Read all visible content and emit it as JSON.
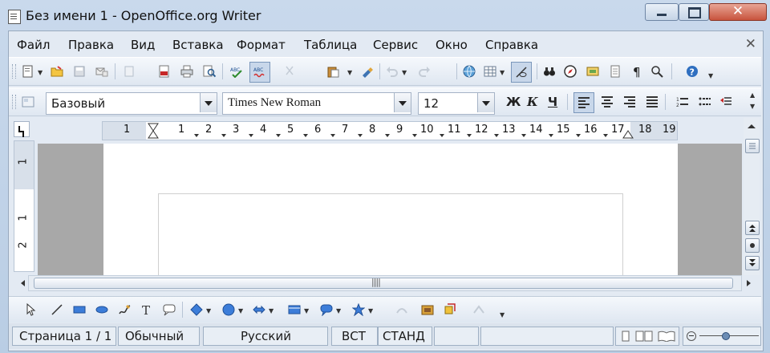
{
  "window": {
    "title": "Без имени 1 - OpenOffice.org Writer"
  },
  "menu": [
    "Файл",
    "Правка",
    "Вид",
    "Вставка",
    "Формат",
    "Таблица",
    "Сервис",
    "Окно",
    "Справка"
  ],
  "formatting": {
    "style": "Базовый",
    "font": "Times New Roman",
    "size": "12",
    "bold_label": "Ж",
    "italic_label": "К",
    "underline_label": "Ч"
  },
  "ruler": {
    "numbers": [
      "1",
      "1",
      "2",
      "3",
      "4",
      "5",
      "6",
      "7",
      "8",
      "9",
      "10",
      "11",
      "12",
      "13",
      "14",
      "15",
      "16",
      "17",
      "18",
      "19"
    ],
    "vertical_numbers": [
      "1",
      "1",
      "2"
    ]
  },
  "statusbar": {
    "page": "Страница  1 / 1",
    "page_style": "Обычный",
    "language": "Русский",
    "insert_mode": "ВСТ",
    "selection_mode": "СТАНД"
  },
  "icons": {
    "standard_toolbar": [
      "new-icon",
      "open-icon",
      "save-icon",
      "email-icon",
      "edit-file-icon",
      "export-pdf-icon",
      "print-icon",
      "page-preview-icon",
      "spellcheck-icon",
      "autospellcheck-icon",
      "cut-icon",
      "copy-icon",
      "paste-icon",
      "format-paintbrush-icon",
      "undo-icon",
      "redo-icon",
      "hyperlink-icon",
      "table-icon",
      "show-draw-functions-icon",
      "find-replace-icon",
      "navigator-icon",
      "gallery-icon",
      "data-sources-icon",
      "formatting-marks-icon",
      "zoom-icon",
      "help-icon"
    ],
    "drawing_toolbar": [
      "select-icon",
      "line-icon",
      "rectangle-icon",
      "ellipse-icon",
      "freeform-icon",
      "text-icon",
      "callout-icon",
      "basic-shapes-icon",
      "symbol-shapes-icon",
      "block-arrows-icon",
      "flowchart-icon",
      "callouts-icon",
      "stars-icon",
      "fontwork-icon",
      "from-file-icon",
      "extrusion-icon"
    ]
  }
}
